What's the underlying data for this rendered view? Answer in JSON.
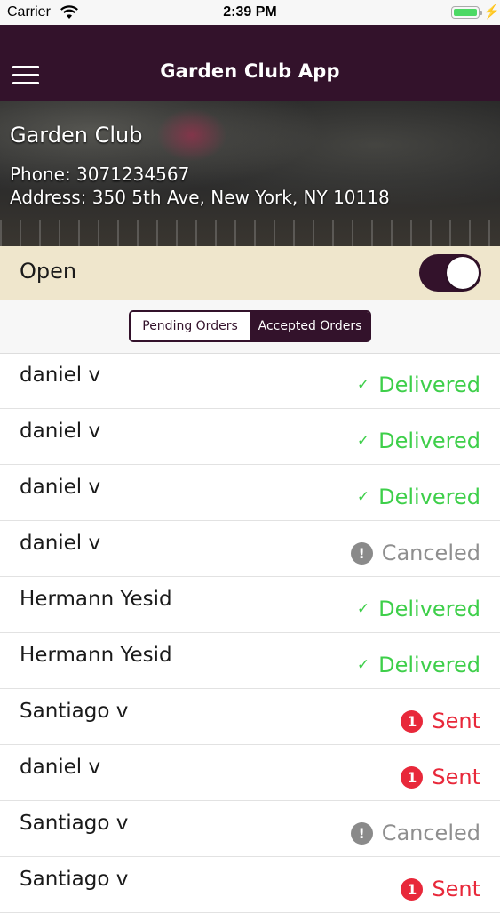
{
  "status_bar": {
    "carrier": "Carrier",
    "time": "2:39 PM",
    "battery_level": 1.0
  },
  "nav": {
    "title": "Garden Club App",
    "menu_icon": "hamburger-icon"
  },
  "store": {
    "name": "Garden Club",
    "phone": "Phone: 3071234567",
    "address": "Address: 350 5th Ave, New York, NY 10118"
  },
  "open_toggle": {
    "label": "Open",
    "on": true
  },
  "segments": {
    "pending": "Pending Orders",
    "accepted": "Accepted Orders",
    "selected": "accepted"
  },
  "orders": [
    {
      "name": "daniel v",
      "status": "Delivered",
      "kind": "delivered",
      "icon": "✓"
    },
    {
      "name": "daniel v",
      "status": "Delivered",
      "kind": "delivered",
      "icon": "✓"
    },
    {
      "name": "daniel v",
      "status": "Delivered",
      "kind": "delivered",
      "icon": "✓"
    },
    {
      "name": "daniel v",
      "status": "Canceled",
      "kind": "canceled",
      "icon": "!"
    },
    {
      "name": "Hermann Yesid",
      "status": "Delivered",
      "kind": "delivered",
      "icon": "✓"
    },
    {
      "name": "Hermann Yesid",
      "status": "Delivered",
      "kind": "delivered",
      "icon": "✓"
    },
    {
      "name": "Santiago v",
      "status": "Sent",
      "kind": "sent",
      "icon": "1"
    },
    {
      "name": "daniel v",
      "status": "Sent",
      "kind": "sent",
      "icon": "1"
    },
    {
      "name": "Santiago v",
      "status": "Canceled",
      "kind": "canceled",
      "icon": "!"
    },
    {
      "name": "Santiago v",
      "status": "Sent",
      "kind": "sent",
      "icon": "1"
    }
  ],
  "colors": {
    "brand": "#33122b",
    "open_row_bg": "#efe6cc",
    "delivered": "#3ecf4a",
    "canceled": "#8f8f8f",
    "sent": "#e8283a"
  }
}
